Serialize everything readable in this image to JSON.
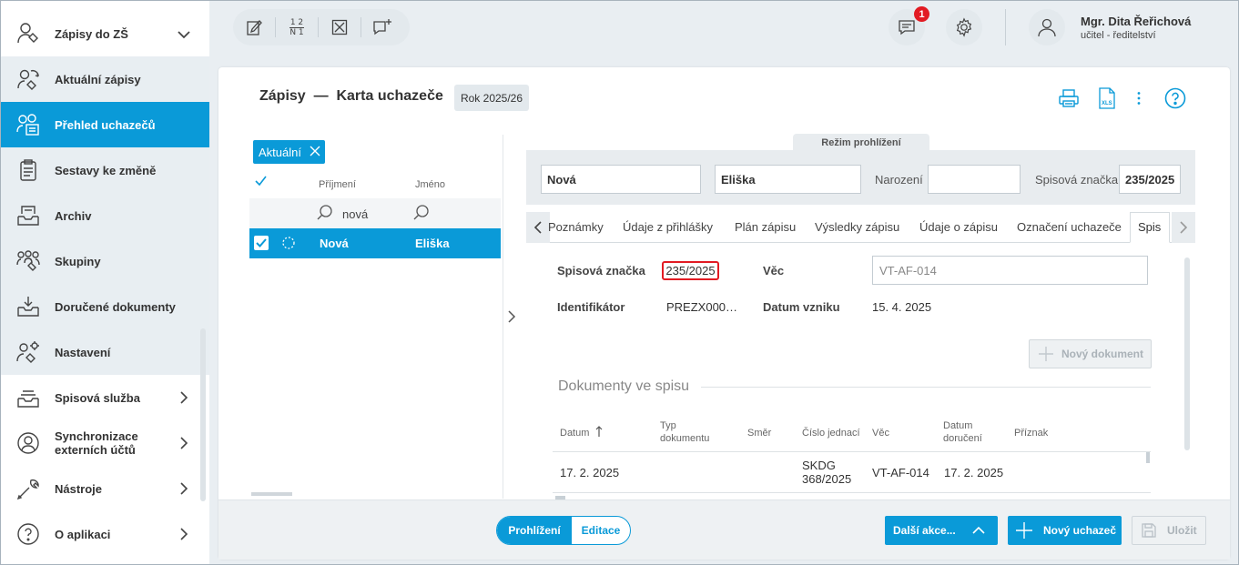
{
  "sidebar": {
    "module": "Zápisy do ZŠ",
    "items": [
      {
        "label": "Aktuální zápisy"
      },
      {
        "label": "Přehled uchazečů"
      },
      {
        "label": "Sestavy ke změně"
      },
      {
        "label": "Archiv"
      },
      {
        "label": "Skupiny"
      },
      {
        "label": "Doručené dokumenty"
      },
      {
        "label": "Nastavení"
      },
      {
        "label": "Spisová služba"
      },
      {
        "label": "Synchronizace"
      },
      {
        "label": "externích účtů"
      },
      {
        "label": "Nástroje"
      },
      {
        "label": "O aplikaci"
      }
    ]
  },
  "topbar": {
    "toolbar_icons": [
      "edit-icon",
      "numbering-icon",
      "close-box-icon",
      "add-comment-icon"
    ],
    "numbering_glyph_top": "1 2",
    "numbering_glyph_bottom": "N 1",
    "notifications_count": "1",
    "user_name": "Mgr. Dita Řeřichová",
    "user_role": "učitel - ředitelství"
  },
  "header": {
    "title": "Zápisy  —  Karta uchazeče",
    "year": "Rok 2025/26"
  },
  "list": {
    "filter_chip": "Aktuální",
    "col_surname": "Příjmení",
    "col_name": "Jméno",
    "filter_surname": "nová",
    "row_surname": "Nová",
    "row_name": "Eliška"
  },
  "detail": {
    "mode": "Režim prohlížení",
    "surname": "Nová",
    "name": "Eliška",
    "birth_label": "Narození",
    "birth_value": "",
    "file_label": "Spisová značka",
    "file_value": "235/2025",
    "tabs": [
      "Poznámky",
      "Údaje z přihlášky",
      "Plán zápisu",
      "Výsledky zápisu",
      "Údaje o zápisu",
      "Označení uchazeče"
    ],
    "active_tab": "Spis",
    "spis": {
      "file_label": "Spisová značka",
      "file_value": "235/2025",
      "matter_label": "Věc",
      "matter_value": "VT-AF-014",
      "id_label": "Identifikátor",
      "id_value": "PREZX000…",
      "created_label": "Datum vzniku",
      "created_value": "15. 4. 2025",
      "new_doc": "Nový dokument",
      "docs_title": "Dokumenty ve spisu",
      "columns": {
        "date": "Datum",
        "type_1": "Typ",
        "type_2": "dokumentu",
        "direction": "Směr",
        "ref_no": "Číslo jednací",
        "matter": "Věc",
        "delivered_1": "Datum",
        "delivered_2": "doručení",
        "flag": "Příznak"
      },
      "rows": [
        {
          "date": "17. 2. 2025",
          "ref_1": "SKDG",
          "ref_2": "368/2025",
          "matter": "VT-AF-014",
          "delivered": "17. 2. 2025"
        }
      ]
    }
  },
  "bottom": {
    "view": "Prohlížení",
    "edit": "Editace",
    "more": "Další akce...",
    "new_applicant": "Nový uchazeč",
    "save": "Uložit"
  },
  "colors": {
    "accent": "#0a9ad8",
    "badge": "#e21b23"
  }
}
